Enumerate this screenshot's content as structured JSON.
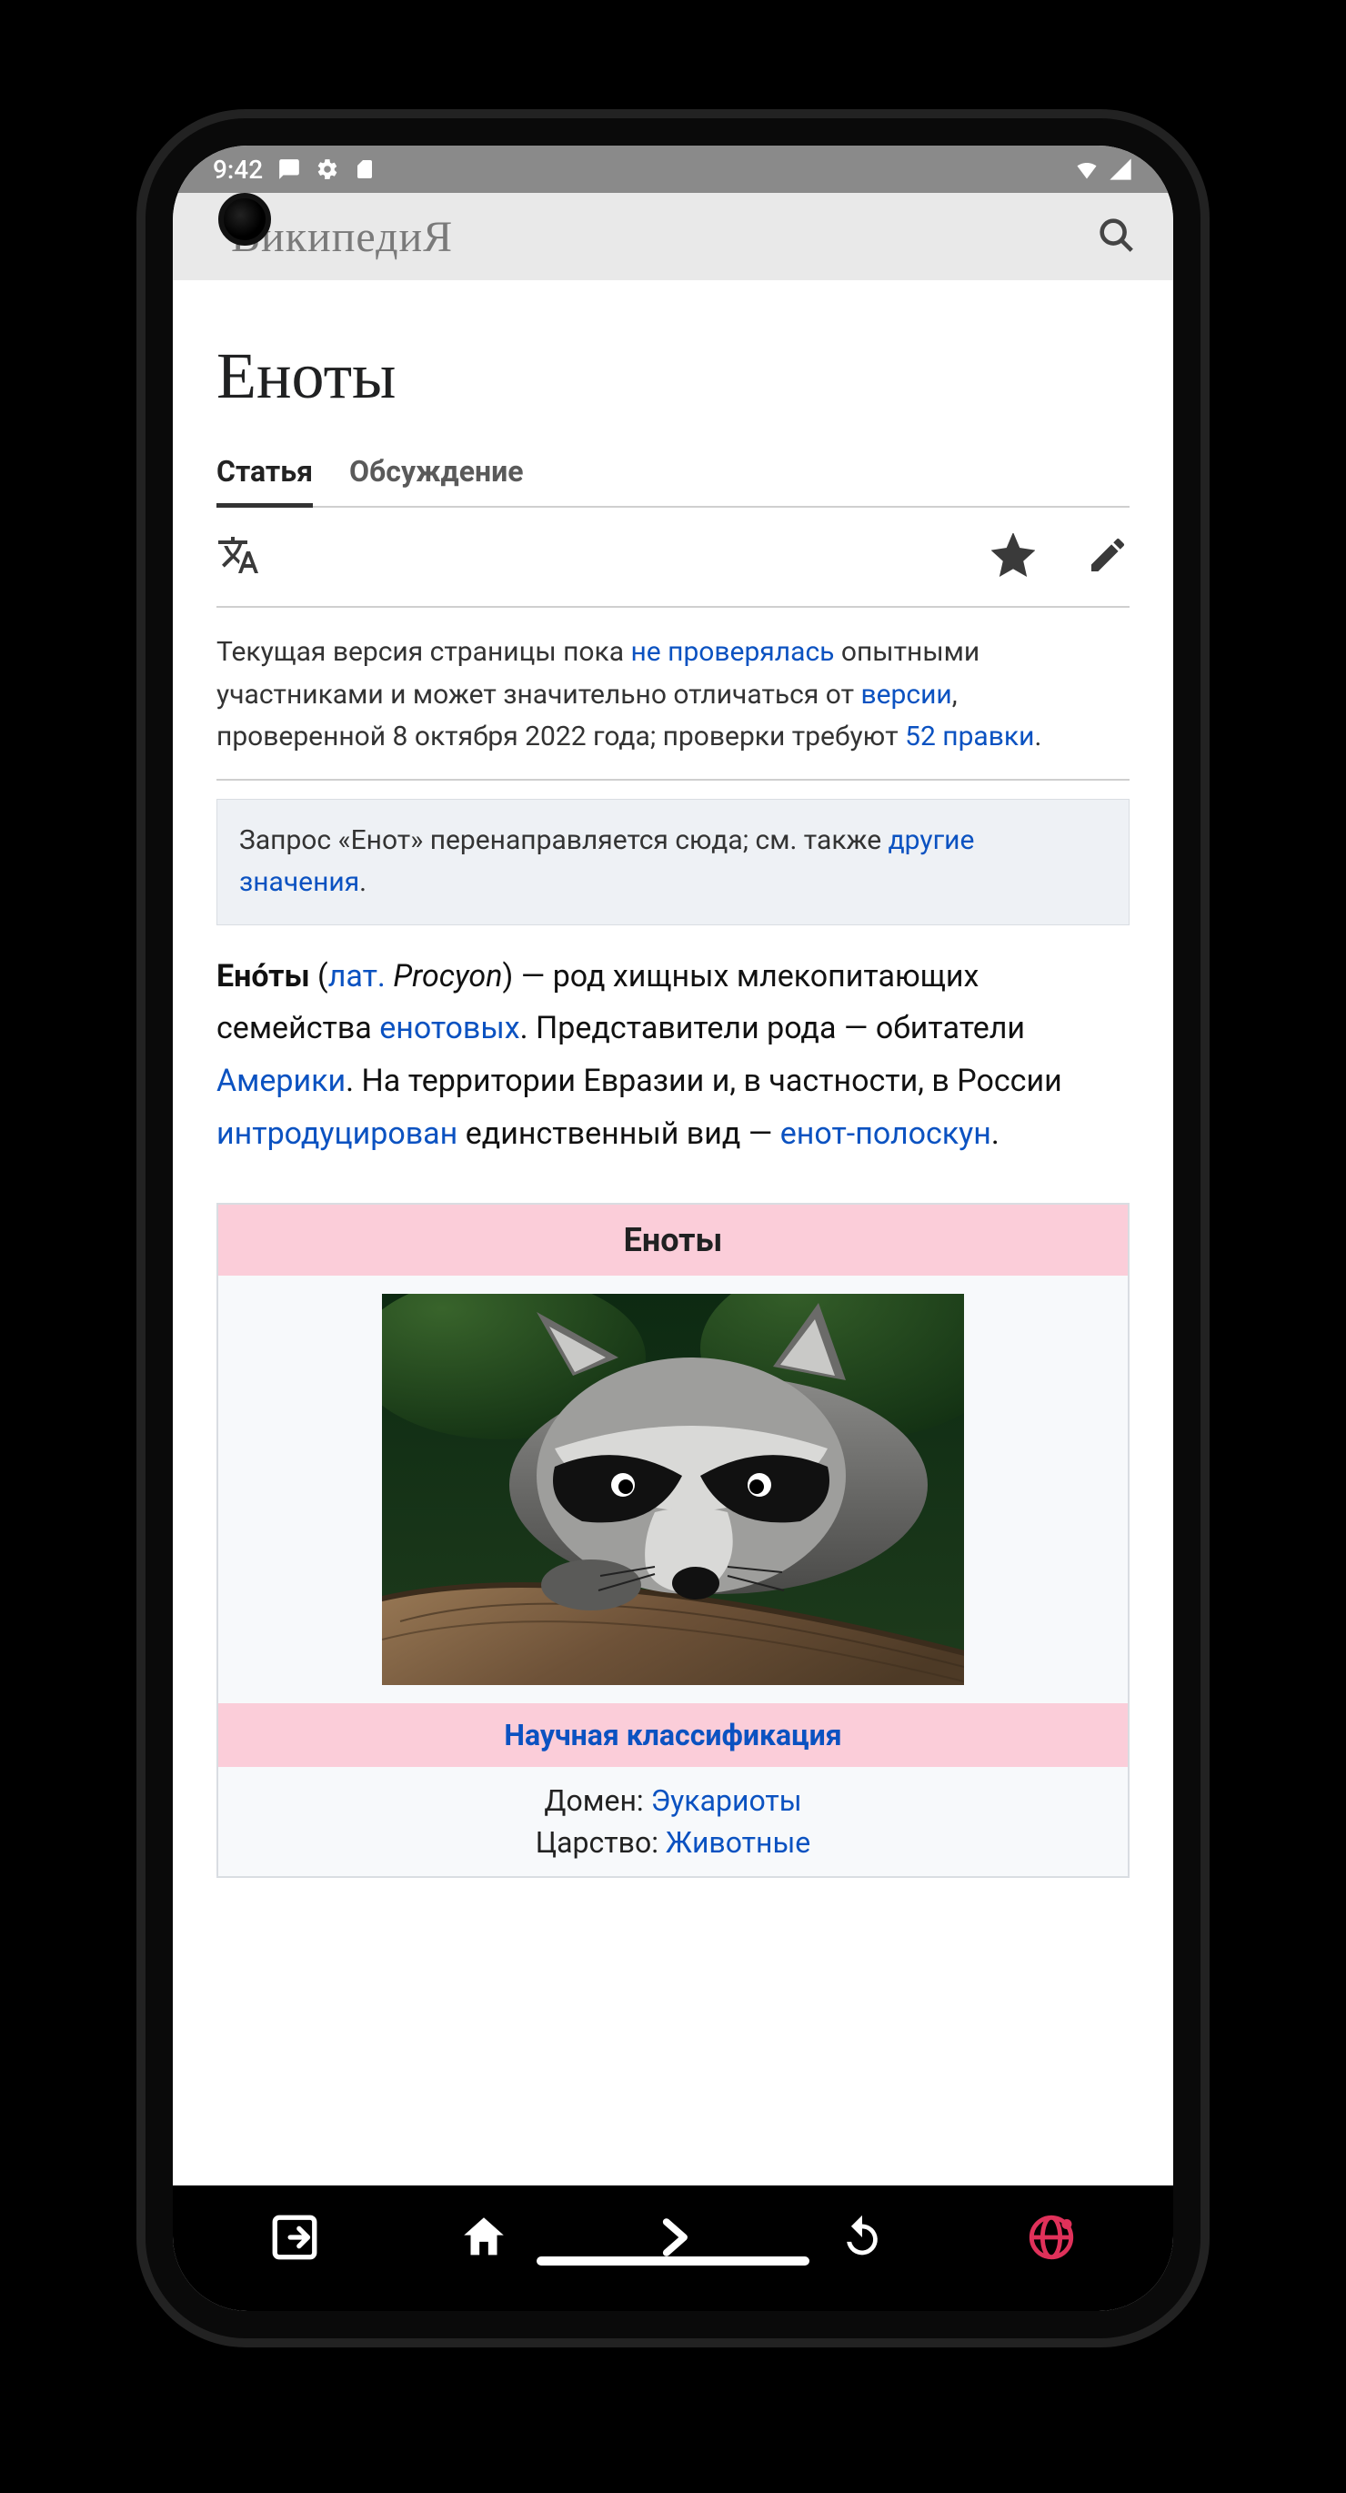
{
  "statusbar": {
    "time": "9:42"
  },
  "header": {
    "logo": "ВикипедиЯ"
  },
  "page": {
    "title": "Еноты"
  },
  "tabs": {
    "article": "Статья",
    "talk": "Обсуждение"
  },
  "notice": {
    "t1": "Текущая версия страницы пока ",
    "link1": "не проверялась",
    "t2": " опытными участниками и может значительно отличаться от ",
    "link2": "версии",
    "t3": ", проверенной 8 октября 2022 года; проверки требуют ",
    "link3": "52 правки",
    "t4": "."
  },
  "hatnote": {
    "t1": "Запрос «Енот» перенаправляется сюда; см. также ",
    "link1": "другие значения",
    "t2": "."
  },
  "lead": {
    "bold": "Ено́ты",
    "t1": " (",
    "lat_link": "лат.",
    "t2": " ",
    "latin": "Procyon",
    "t3": ") — род хищных млекопитающих семейства ",
    "link1": "енотовых",
    "t4": ". Представители рода — обитатели ",
    "link2": "Америки",
    "t5": ". На территории Евразии и, в частности, в России ",
    "link3": "интродуцирован",
    "t6": " единственный вид — ",
    "link4": "енот-полоскун",
    "t7": "."
  },
  "infobox": {
    "title": "Еноты",
    "sub": "Научная классификация",
    "rows": [
      {
        "label": "Домен:",
        "value": "Эукариоты"
      },
      {
        "label": "Царство:",
        "value": "Животные"
      }
    ]
  }
}
